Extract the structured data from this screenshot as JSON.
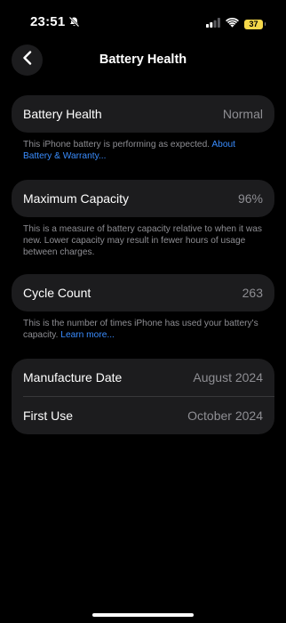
{
  "status_bar": {
    "time": "23:51",
    "battery_level": "37",
    "icons": [
      "bell-slash-icon",
      "signal-icon",
      "wifi-icon",
      "battery-icon"
    ]
  },
  "nav": {
    "back_icon": "chevron-left-icon",
    "title": "Battery Health"
  },
  "battery_health": {
    "label": "Battery Health",
    "value": "Normal",
    "note_text": "This iPhone battery is performing as expected. ",
    "note_link": "About Battery & Warranty..."
  },
  "maximum_capacity": {
    "label": "Maximum Capacity",
    "value": "96%",
    "note_text": "This is a measure of battery capacity relative to when it was new. Lower capacity may result in fewer hours of usage between charges."
  },
  "cycle_count": {
    "label": "Cycle Count",
    "value": "263",
    "note_text": "This is the number of times iPhone has used your battery's capacity. ",
    "note_link": "Learn more..."
  },
  "dates": {
    "manufacture_label": "Manufacture Date",
    "manufacture_value": "August 2024",
    "first_use_label": "First Use",
    "first_use_value": "October 2024"
  },
  "colors": {
    "background": "#000000",
    "card": "#1c1c1e",
    "secondary_text": "#8e8e93",
    "link": "#3a8dff",
    "battery_badge": "#f5d84a"
  }
}
